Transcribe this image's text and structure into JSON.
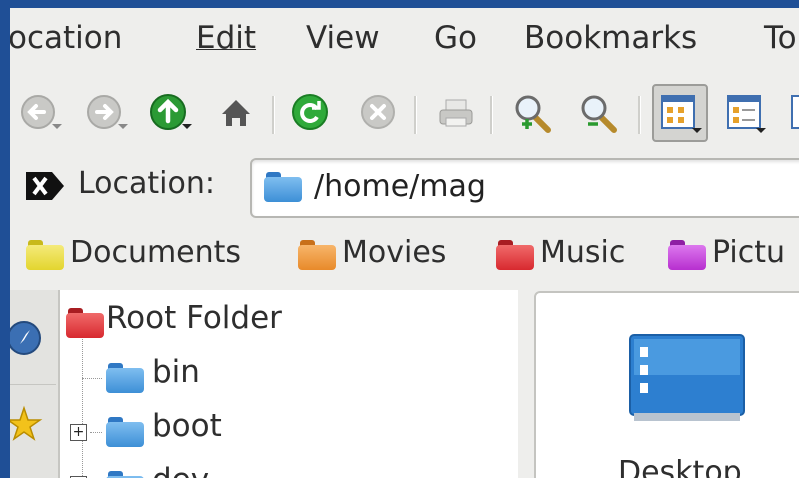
{
  "menubar": {
    "items": [
      {
        "label": "Location",
        "display": "ocation"
      },
      {
        "label": "Edit"
      },
      {
        "label": "View"
      },
      {
        "label": "Go"
      },
      {
        "label": "Bookmarks"
      },
      {
        "label": "To"
      }
    ]
  },
  "toolbar": {
    "icons": [
      "back-icon",
      "forward-icon",
      "up-icon",
      "home-icon",
      "reload-icon",
      "stop-icon",
      "print-icon",
      "zoom-in-icon",
      "zoom-out-icon",
      "icon-view-icon",
      "detailed-view-icon"
    ]
  },
  "location_bar": {
    "label": "Location:",
    "value": "/home/mag"
  },
  "bookmarks": [
    {
      "label": "Documents",
      "color": "#e3d52e"
    },
    {
      "label": "Movies",
      "color": "#e88a2a"
    },
    {
      "label": "Music",
      "color": "#d8292f"
    },
    {
      "label": "Pictu",
      "color": "#b72fcf"
    }
  ],
  "tree": {
    "root": {
      "label": "Root Folder",
      "color": "#d8292f"
    },
    "items": [
      {
        "label": "bin",
        "expander": ""
      },
      {
        "label": "boot",
        "expander": "+"
      },
      {
        "label": "dev",
        "expander": "+"
      }
    ]
  },
  "view": {
    "items": [
      {
        "label": "Desktop"
      }
    ]
  },
  "colors": {
    "folder_blue": "#3d8fd6",
    "desktop_blue": "#2d7fd0"
  }
}
